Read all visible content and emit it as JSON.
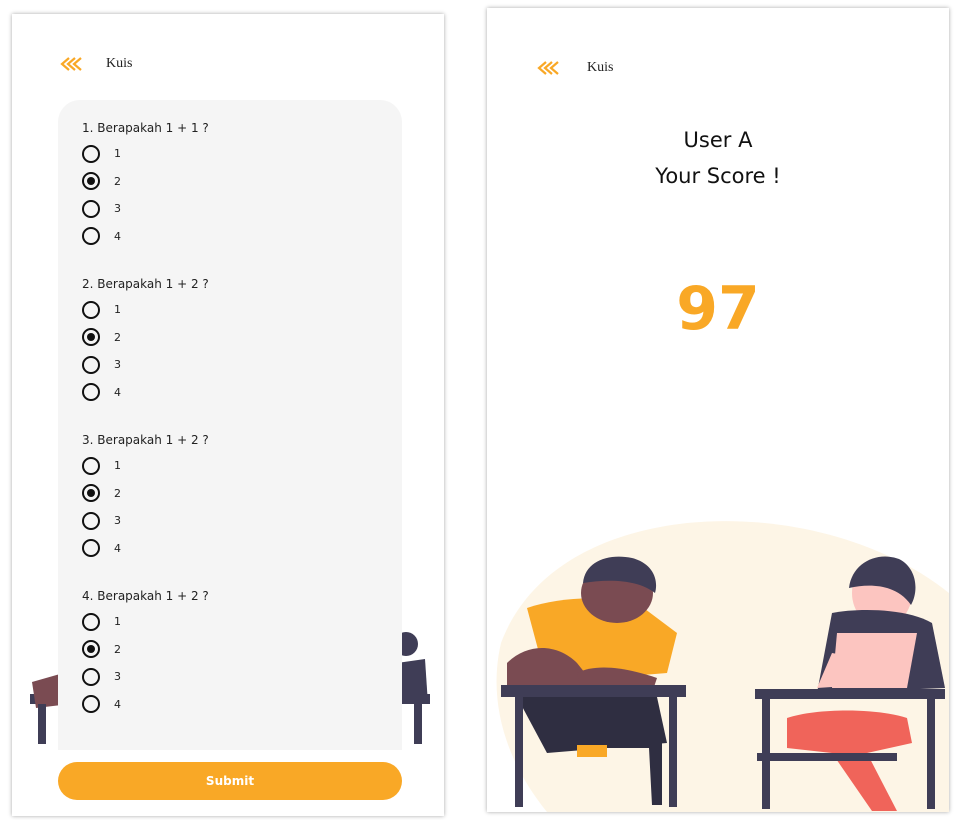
{
  "quiz_screen": {
    "title": "Kuis",
    "questions": [
      {
        "text": "1. Berapakah 1 + 1 ?",
        "options": [
          "1",
          "2",
          "3",
          "4"
        ],
        "selected": 1
      },
      {
        "text": "2. Berapakah 1 + 2 ?",
        "options": [
          "1",
          "2",
          "3",
          "4"
        ],
        "selected": 1
      },
      {
        "text": "3. Berapakah 1 + 2 ?",
        "options": [
          "1",
          "2",
          "3",
          "4"
        ],
        "selected": 1
      },
      {
        "text": "4. Berapakah 1 + 2 ?",
        "options": [
          "1",
          "2",
          "3",
          "4"
        ],
        "selected": 1
      }
    ],
    "submit_label": "Submit"
  },
  "score_screen": {
    "title": "Kuis",
    "user_name": "User A",
    "score_label": "Your Score !",
    "score_value": "97"
  },
  "colors": {
    "accent": "#f9a826",
    "card_bg": "#f5f5f5",
    "skin_dark": "#7a4b52",
    "hair": "#3f3d56",
    "desk": "#3f3d56",
    "pink_shirt": "#fcc5c0",
    "coral": "#f0645a",
    "blob": "#fdf5e6"
  },
  "icons": {
    "back": "chevron-double-left-icon"
  }
}
